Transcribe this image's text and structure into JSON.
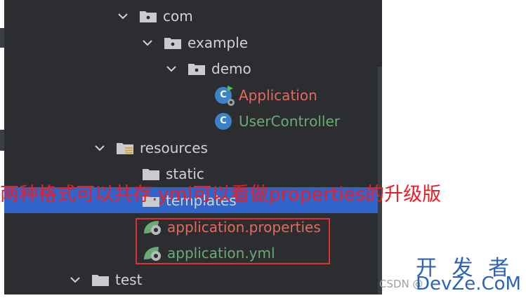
{
  "tree": {
    "items": [
      {
        "label": "com",
        "type": "package"
      },
      {
        "label": "example",
        "type": "package"
      },
      {
        "label": "demo",
        "type": "package"
      },
      {
        "label": "Application",
        "type": "spring-boot-class"
      },
      {
        "label": "UserController",
        "type": "class"
      },
      {
        "label": "resources",
        "type": "resources-folder"
      },
      {
        "label": "static",
        "type": "folder"
      },
      {
        "label": "templates",
        "type": "folder"
      },
      {
        "label": "application.properties",
        "type": "spring-config"
      },
      {
        "label": "application.yml",
        "type": "spring-config"
      },
      {
        "label": "test",
        "type": "folder"
      }
    ],
    "class_icon_letter": "C"
  },
  "annotation": {
    "text": "两种格式可以共存.yml可以看做properties的升级版"
  },
  "watermarks": {
    "cn": "开 发 者",
    "en": "DevZe.CoM",
    "csdn": "CSDN @"
  },
  "colors": {
    "panel_bg": "#2b2d30",
    "selection": "#2f65ca",
    "text": "#cfd2d6",
    "modified_red": "#e26b5c",
    "added_green": "#6aab73",
    "annotation_red": "#ee1c24",
    "watermark_blue": "#2c63b5"
  }
}
